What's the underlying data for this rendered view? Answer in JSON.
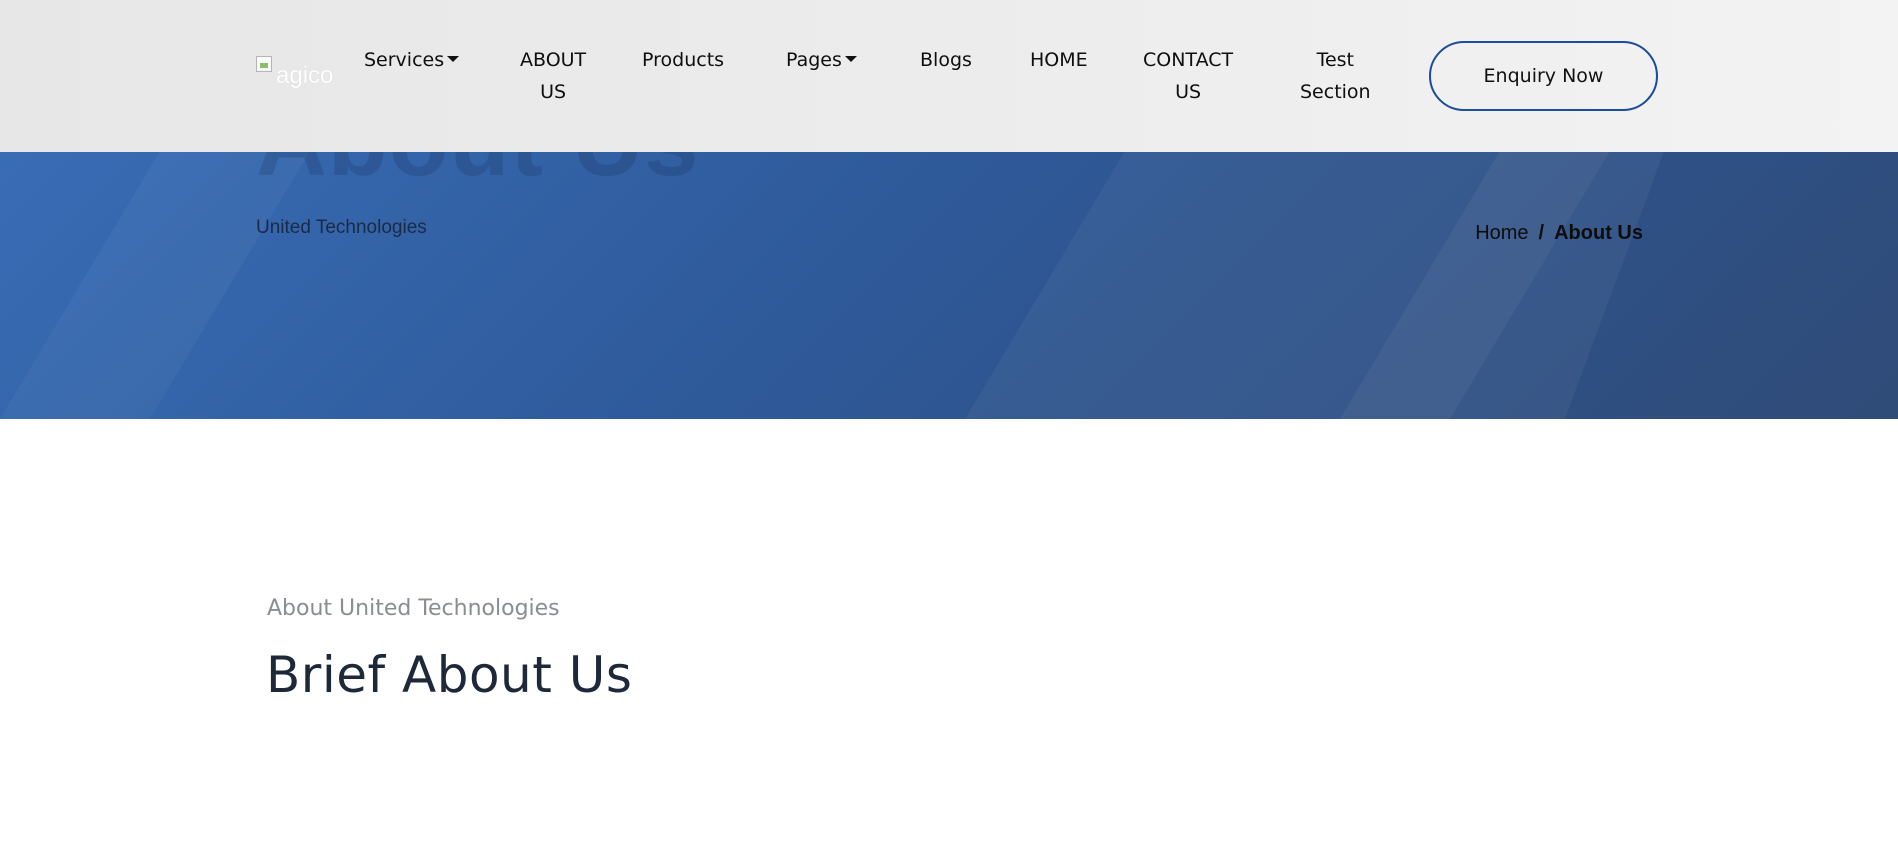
{
  "header": {
    "logo_alt": "agico",
    "nav": {
      "services": "Services",
      "about_line1": "ABOUT",
      "about_line2": "US",
      "products": "Products",
      "pages": "Pages",
      "blogs": "Blogs",
      "home": "HOME",
      "contact_line1": "CONTACT",
      "contact_line2": "US",
      "test_line1": "Test",
      "test_line2": "Section"
    },
    "enquiry_label": "Enquiry Now"
  },
  "hero": {
    "big_title": "About Us",
    "subtitle": "United Technologies",
    "breadcrumb": {
      "home": "Home",
      "separator": "/",
      "current": "About Us"
    }
  },
  "about": {
    "eyebrow": "About United Technologies",
    "title": "Brief About Us"
  },
  "colors": {
    "hero_start": "#3a6fb9",
    "hero_end": "#2f4b78",
    "button_border": "#1c4c9a",
    "title_text": "#1d2838",
    "eyebrow_text": "#8a8d92"
  },
  "icons": {
    "dropdown": "caret-down-icon",
    "logo": "broken-image-icon"
  }
}
